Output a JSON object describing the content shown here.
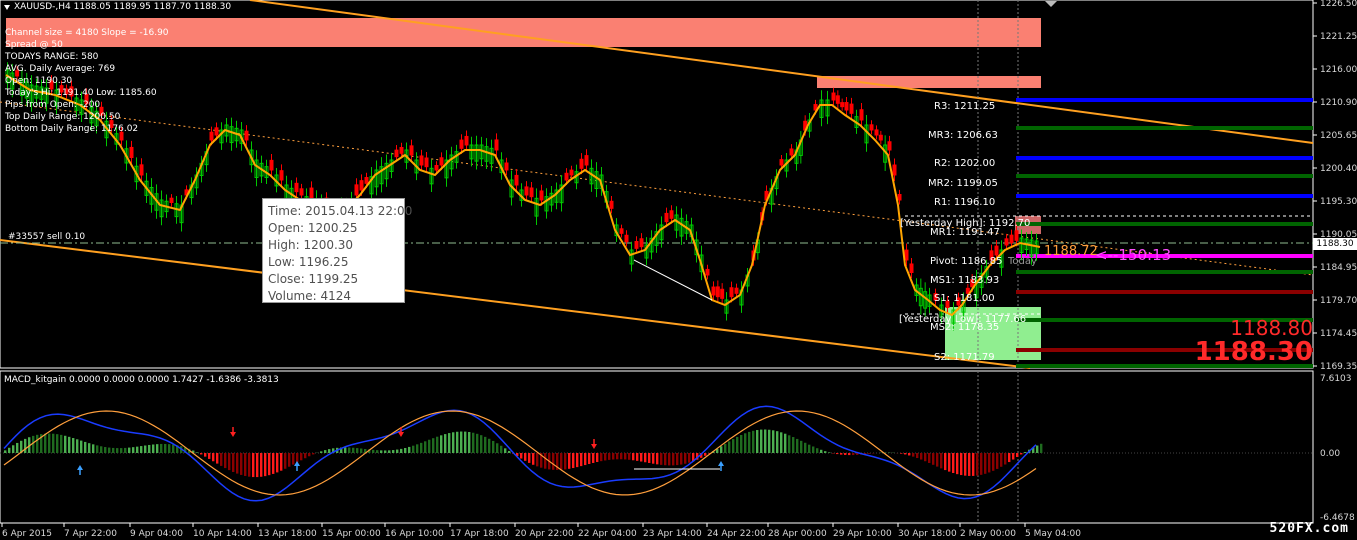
{
  "chart_header": {
    "label": "XAUUSD-,H4  1188.05 1189.95 1187.70 1188.30"
  },
  "info": {
    "lines": [
      "Channel size = 4180 Slope = -16.90",
      "Spread @ 50",
      "TODAYS RANGE: 580",
      "AVG. Daily Average: 769",
      "Open: 1190.30",
      "Today's Hi: 1191.40  Low: 1185.60",
      "Pips from Open: -200",
      "Top Daily Range: 1200.50",
      "Bottom Daily Range: 1176.02"
    ]
  },
  "order_label": "#33557 sell 0.10",
  "tooltip": {
    "time": "Time: 2015.04.13 22:00",
    "open": "Open: 1200.25",
    "high": "High: 1200.30",
    "low": "Low:  1196.25",
    "close": "Close: 1199.25",
    "volume": "Volume: 4124"
  },
  "levels": {
    "r3": "R3: 1211.25",
    "mr3": "MR3: 1206.63",
    "r2": "R2: 1202.00",
    "mr2": "MR2: 1199.05",
    "r1": "R1: 1196.10",
    "yesterday_high": "[Yesterday High]: 1192.70",
    "mr1": "MR1: 1191.47",
    "pivot": "Pivot: 1186.85",
    "today": "Today",
    "ms1": "MS1: 1183.93",
    "s1": "S1: 1181.00",
    "yesterday_low": "[Yesterday Low]: 1177.66",
    "ms2": "MS2: 1178.35",
    "s2": "S2: 1171.79"
  },
  "current_price_label": "1188.72",
  "timer": "<--150:13",
  "ask_price": "1188.80",
  "bid_price": "1188.30",
  "price_tag": "1188.30",
  "macd_header": "MACD_kitgain 0.0000 0.0000 0.0000 1.7427 -1.6386 -3.3813",
  "price_axis": [
    "1226.50",
    "1221.25",
    "1216.00",
    "1210.90",
    "1205.65",
    "1200.40",
    "1195.30",
    "1190.05",
    "1184.95",
    "1179.70",
    "1174.45",
    "1169.35"
  ],
  "macd_axis": [
    "7.6103",
    "0.00",
    "-6.4678"
  ],
  "time_axis": [
    "6 Apr 2015",
    "7 Apr 22:00",
    "9 Apr 04:00",
    "10 Apr 14:00",
    "13 Apr 18:00",
    "15 Apr 00:00",
    "16 Apr 10:00",
    "17 Apr 18:00",
    "20 Apr 22:00",
    "22 Apr 04:00",
    "23 Apr 14:00",
    "24 Apr 22:00",
    "28 Apr 00:00",
    "29 Apr 10:00",
    "30 Apr 18:00",
    "2 May 00:00",
    "5 May 04:00"
  ],
  "watermark": "520FX.com",
  "colors": {
    "background": "#000000",
    "bull": "#00c800",
    "bear": "#ff0000",
    "ma": "#ffa500",
    "channel": "#ffa020",
    "zone": "#fa8072",
    "macd_line": "#1a3cff",
    "signal_line": "#ff9f3d",
    "pivot_r": "#0000ff",
    "pivot_mr": "#006400",
    "pivot_p": "#ff00ff",
    "pivot_s": "#8b0000"
  }
}
